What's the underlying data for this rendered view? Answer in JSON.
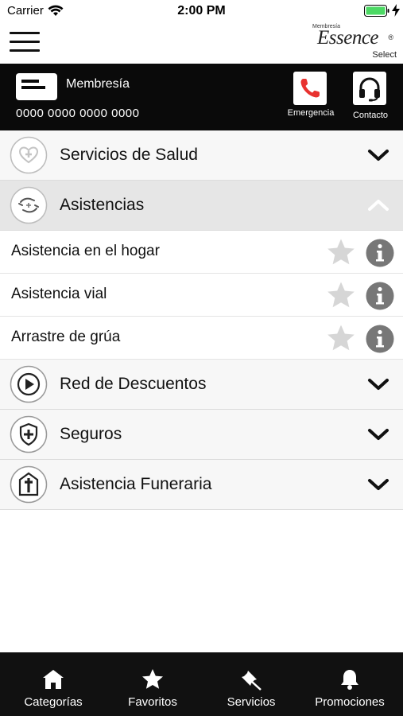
{
  "status_bar": {
    "carrier": "Carrier",
    "time": "2:00 PM"
  },
  "logo": {
    "top": "Membresía",
    "main": "Essence",
    "sub": "Select",
    "reg": "®"
  },
  "membership": {
    "label": "Membresía",
    "number": "0000 0000 0000 0000"
  },
  "actions": {
    "emergency": "Emergencia",
    "contact": "Contacto"
  },
  "categories": [
    {
      "label": "Servicios de Salud",
      "icon": "heart-plus-icon",
      "expanded": false
    },
    {
      "label": "Asistencias",
      "icon": "hands-assist-icon",
      "expanded": true
    },
    {
      "label": "Red de Descuentos",
      "icon": "play-circle-icon",
      "expanded": false
    },
    {
      "label": "Seguros",
      "icon": "shield-plus-icon",
      "expanded": false
    },
    {
      "label": "Asistencia Funeraria",
      "icon": "tomb-cross-icon",
      "expanded": false
    }
  ],
  "subitems": [
    {
      "label": "Asistencia en el hogar"
    },
    {
      "label": "Asistencia vial"
    },
    {
      "label": "Arrastre de grúa"
    }
  ],
  "tabs": [
    {
      "label": "Categorías",
      "icon": "home-icon"
    },
    {
      "label": "Favoritos",
      "icon": "star-icon"
    },
    {
      "label": "Servicios",
      "icon": "pin-icon"
    },
    {
      "label": "Promociones",
      "icon": "bell-icon"
    }
  ],
  "colors": {
    "accent_red": "#e8322f",
    "header_bg": "#0a0a0a",
    "tab_bg": "#111111"
  }
}
